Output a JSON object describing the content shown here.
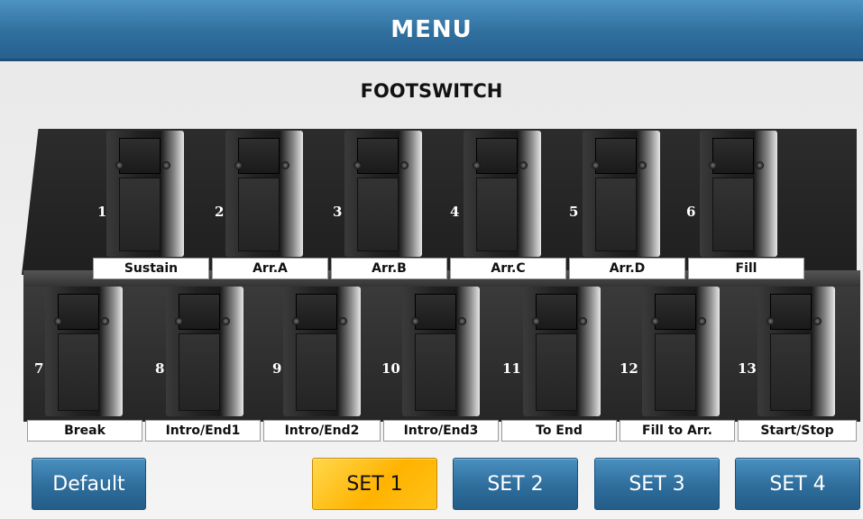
{
  "header": {
    "title": "MENU"
  },
  "page": {
    "title": "FOOTSWITCH"
  },
  "pedals_top": [
    {
      "number": "1",
      "label": "Sustain"
    },
    {
      "number": "2",
      "label": "Arr.A"
    },
    {
      "number": "3",
      "label": "Arr.B"
    },
    {
      "number": "4",
      "label": "Arr.C"
    },
    {
      "number": "5",
      "label": "Arr.D"
    },
    {
      "number": "6",
      "label": "Fill"
    }
  ],
  "pedals_bottom": [
    {
      "number": "7",
      "label": "Break"
    },
    {
      "number": "8",
      "label": "Intro/End1"
    },
    {
      "number": "9",
      "label": "Intro/End2"
    },
    {
      "number": "10",
      "label": "Intro/End3"
    },
    {
      "number": "11",
      "label": "To End"
    },
    {
      "number": "12",
      "label": "Fill to Arr."
    },
    {
      "number": "13",
      "label": "Start/Stop"
    }
  ],
  "buttons": {
    "default": "Default",
    "sets": [
      "SET 1",
      "SET 2",
      "SET 3",
      "SET 4"
    ],
    "active_set": "SET 1"
  },
  "colors": {
    "header_blue": "#2f6f9e",
    "button_blue": "#2e6d9c",
    "active_yellow": "#ffb300"
  }
}
